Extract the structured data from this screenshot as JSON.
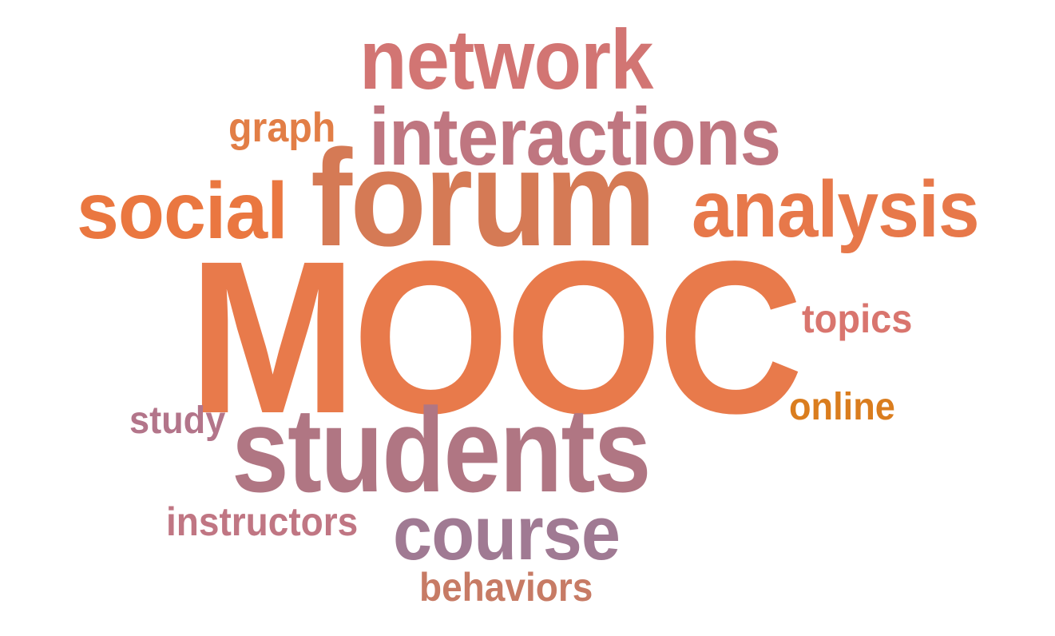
{
  "words": {
    "mooc": {
      "text": "MOOC",
      "color": "#E87A4B"
    },
    "forum": {
      "text": "forum",
      "color": "#D57A55"
    },
    "students": {
      "text": "students",
      "color": "#B07683"
    },
    "network": {
      "text": "network",
      "color": "#D27573"
    },
    "interactions": {
      "text": "interactions",
      "color": "#BF7680"
    },
    "social": {
      "text": "social",
      "color": "#EA7740"
    },
    "analysis": {
      "text": "analysis",
      "color": "#E7784A"
    },
    "course": {
      "text": "course",
      "color": "#A07A93"
    },
    "graph": {
      "text": "graph",
      "color": "#E27E46"
    },
    "topics": {
      "text": "topics",
      "color": "#D9756E"
    },
    "online": {
      "text": "online",
      "color": "#DA7D1E"
    },
    "study": {
      "text": "study",
      "color": "#B3758A"
    },
    "instructors": {
      "text": "instructors",
      "color": "#C07683"
    },
    "behaviors": {
      "text": "behaviors",
      "color": "#C77B65"
    }
  }
}
